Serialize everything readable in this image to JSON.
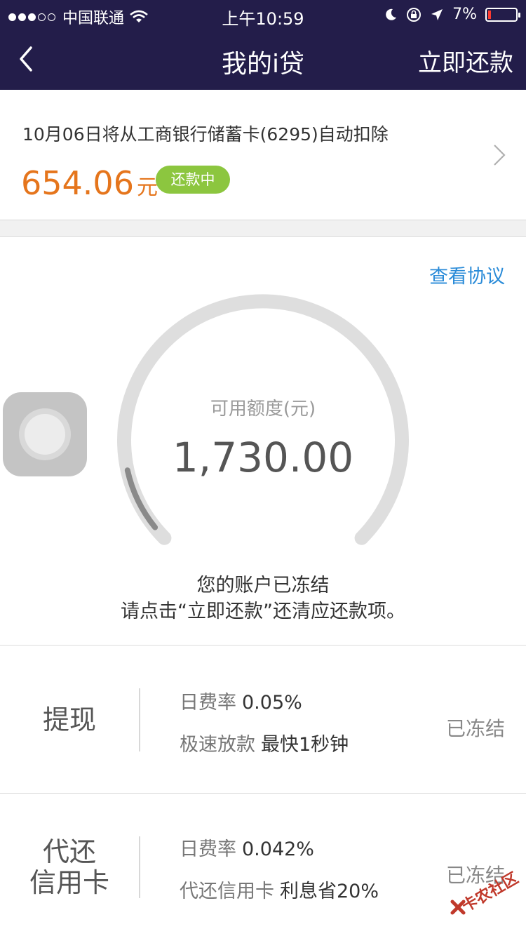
{
  "status_bar": {
    "carrier": "中国联通",
    "time": "上午10:59",
    "battery": "7%",
    "battery_level": 0.07
  },
  "nav": {
    "title": "我的i贷",
    "action": "立即还款",
    "back_icon": "chevron-left-icon"
  },
  "repayment": {
    "note": "10月06日将从工商银行储蓄卡(6295)自动扣除",
    "amount": "654.06",
    "unit": "元",
    "status": "还款中",
    "accent_color": "#e5751c",
    "badge_color": "#8cc63f"
  },
  "credit": {
    "agreement_link": "查看协议",
    "available_label": "可用额度(元)",
    "available_value": "1,730.00",
    "gauge_fill_fraction": 0.12,
    "frozen_line1": "您的账户已冻结",
    "frozen_line2": "请点击“立即还款”还清应还款项。",
    "link_color": "#2a8bd8"
  },
  "products": [
    {
      "name": "提现",
      "rate_label": "日费率",
      "rate_value": "0.05%",
      "feature_label": "极速放款",
      "feature_value": "最快1秒钟",
      "status": "已冻结"
    },
    {
      "name_line1": "代还",
      "name_line2": "信用卡",
      "rate_label": "日费率",
      "rate_value": "0.042%",
      "feature_label": "代还信用卡",
      "feature_value": "利息省20%",
      "status": "已冻结"
    }
  ],
  "watermark": {
    "text": "卡农社区"
  },
  "theme": {
    "header_bg": "#231d4a"
  }
}
